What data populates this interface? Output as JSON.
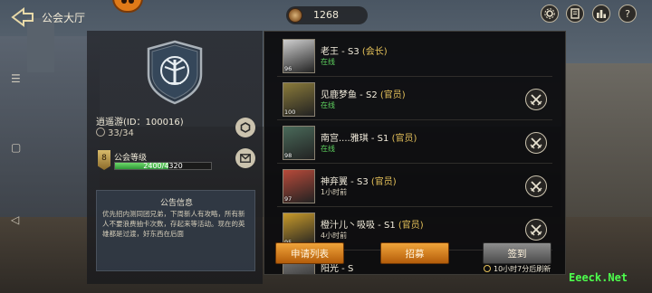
{
  "header": {
    "title": "公会大厅",
    "currency_amount": "1268",
    "icons": [
      "gear-icon",
      "book-icon",
      "ranking-icon",
      "help-icon"
    ],
    "help_glyph": "?"
  },
  "guild": {
    "name_line": "逍遥游(ID：100016)",
    "member_count": "33/34",
    "level": "8",
    "level_label": "公会等级",
    "xp_text": "2400/4320",
    "xp_fraction": 0.556,
    "notice_title": "公告信息",
    "notice_text": "优先招内测同团兄弟，下周新人有攻略，所有新人不要浪费抽卡次数，存起来等活动。现在的英雄都是过渡，好东西在后面"
  },
  "members": [
    {
      "level": "96",
      "name": "老王 - S3",
      "role": "(会长)",
      "status": "在线",
      "online": true,
      "kick": false,
      "avatar_color": "#cfcfcf"
    },
    {
      "level": "100",
      "name": "见鹿梦鱼 - S2",
      "role": "(官员)",
      "status": "在线",
      "online": true,
      "kick": true,
      "avatar_color": "#8a7a3a"
    },
    {
      "level": "98",
      "name": "南宫....雅琪 - S1",
      "role": "(官员)",
      "status": "在线",
      "online": true,
      "kick": true,
      "avatar_color": "#4a6a5a"
    },
    {
      "level": "97",
      "name": "神弃翼 - S3",
      "role": "(官员)",
      "status": "1小时前",
      "online": false,
      "kick": true,
      "avatar_color": "#b84a3a"
    },
    {
      "level": "95",
      "name": "橙汁儿丶吸吸 - S1",
      "role": "(官员)",
      "status": "4小时前",
      "online": false,
      "kick": true,
      "avatar_color": "#c89a2a"
    },
    {
      "level": "",
      "name": "阳光 - S",
      "role": "",
      "status": "",
      "online": false,
      "kick": false,
      "avatar_color": "#7a7a7a"
    }
  ],
  "actions": {
    "apply_list": "申请列表",
    "recruit": "招募",
    "sign_in": "签到",
    "refresh_text": "10小时7分后刷新"
  },
  "watermark": "Eeeck.Net",
  "colors": {
    "accent_orange": "#e08a20",
    "online_green": "#5fd35f",
    "role_gold": "#e6c25a"
  }
}
